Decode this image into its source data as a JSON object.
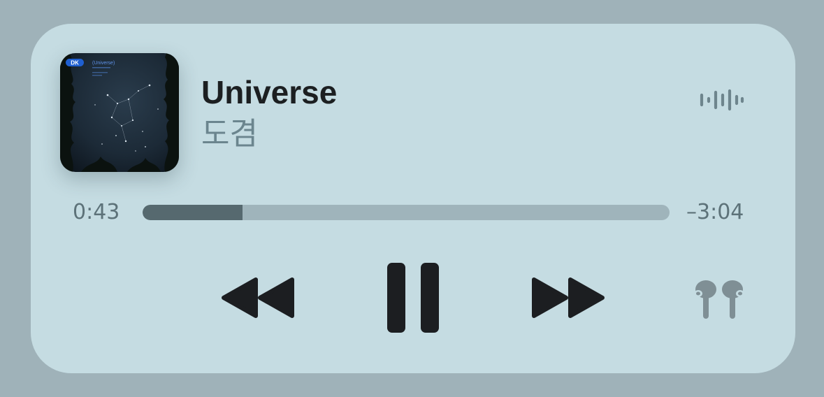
{
  "now_playing": {
    "title": "Universe",
    "artist": "도겸",
    "album_art": {
      "badge": "DK",
      "album_title": "(Universe)",
      "lines": [
        "",
        "",
        ""
      ]
    }
  },
  "progress": {
    "elapsed": "0:43",
    "remaining": "–3:04",
    "fraction": 0.19
  },
  "controls": {
    "rewind_icon": "rewind-icon",
    "pause_icon": "pause-icon",
    "forward_icon": "fast-forward-icon",
    "output_icon": "airpods-pro-icon",
    "waveform_icon": "audio-waveform-icon"
  },
  "colors": {
    "background": "#9fb2b9",
    "card": "#c5dce2",
    "title": "#1c1f21",
    "artist": "#6b858e",
    "progress_fill": "#56696f",
    "progress_track": "#9fb4bb",
    "controls": "#1c1e21",
    "airpods": "#7f8f95"
  }
}
